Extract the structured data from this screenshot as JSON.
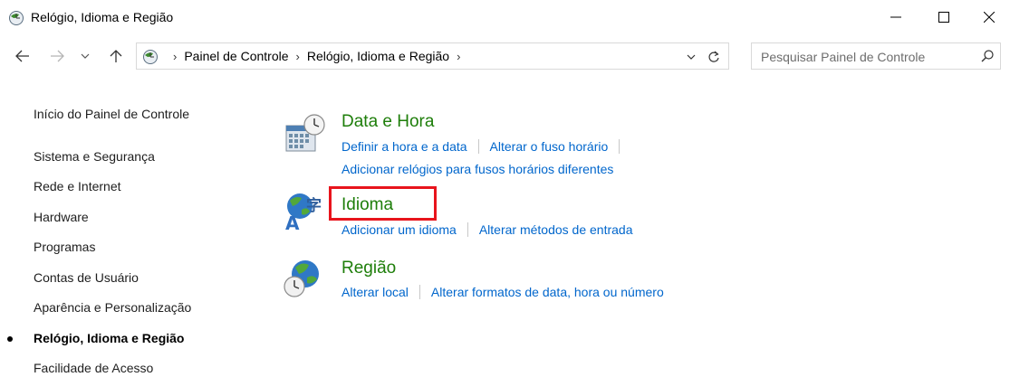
{
  "window": {
    "title": "Relógio, Idioma e Região",
    "icon": "clock-globe-icon"
  },
  "navigation": {
    "breadcrumbs": [
      "Painel de Controle",
      "Relógio, Idioma e Região"
    ],
    "search_placeholder": "Pesquisar Painel de Controle"
  },
  "sidebar": {
    "home": "Início do Painel de Controle",
    "items": [
      "Sistema e Segurança",
      "Rede e Internet",
      "Hardware",
      "Programas",
      "Contas de Usuário",
      "Aparência e Personalização",
      "Relógio, Idioma e Região",
      "Facilidade de Acesso"
    ],
    "current_item": "Relógio, Idioma e Região"
  },
  "categories": [
    {
      "title": "Data e Hora",
      "icon": "calendar-clock-icon",
      "links": [
        [
          "Definir a hora e a data",
          "Alterar o fuso horário"
        ],
        [
          "Adicionar relógios para fusos horários diferentes"
        ]
      ]
    },
    {
      "title": "Idioma",
      "icon": "language-globe-icon",
      "links": [
        [
          "Adicionar um idioma",
          "Alterar métodos de entrada"
        ]
      ],
      "highlighted": true
    },
    {
      "title": "Região",
      "icon": "region-globe-clock-icon",
      "links": [
        [
          "Alterar local",
          "Alterar formatos de data, hora ou número"
        ]
      ]
    }
  ],
  "colors": {
    "category_title": "#1e7e0a",
    "link": "#0066cc",
    "highlight": "#e8141c"
  }
}
